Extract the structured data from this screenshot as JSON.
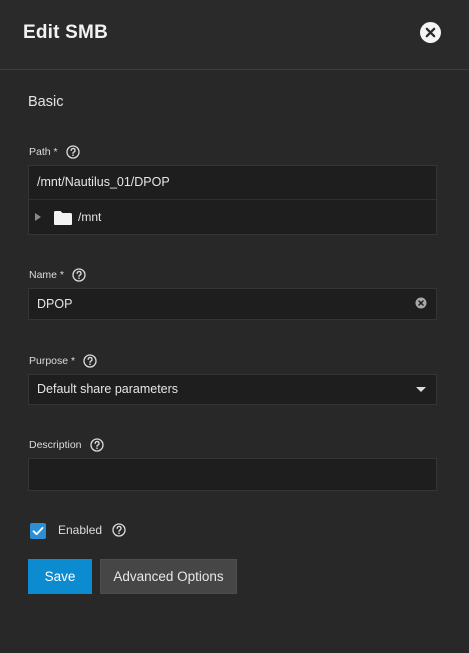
{
  "dialog": {
    "title": "Edit SMB",
    "close_icon": "close-circle-icon"
  },
  "section": {
    "title": "Basic"
  },
  "path": {
    "label": "Path *",
    "value": "/mnt/Nautilus_01/DPOP",
    "tree": {
      "expand_icon": "caret-right-icon",
      "folder_icon": "folder-icon",
      "label": "/mnt"
    }
  },
  "name": {
    "label": "Name *",
    "value": "DPOP",
    "clear_icon": "clear-circle-icon"
  },
  "purpose": {
    "label": "Purpose *",
    "selected": "Default share parameters"
  },
  "description": {
    "label": "Description",
    "value": ""
  },
  "enabled": {
    "label": "Enabled",
    "checked": true
  },
  "buttons": {
    "save": "Save",
    "advanced": "Advanced Options"
  },
  "colors": {
    "background": "#282828",
    "field_background": "#1e1e1e",
    "accent": "#0d8bd0",
    "checkbox": "#2d8fd3",
    "secondary_button": "#464646"
  }
}
